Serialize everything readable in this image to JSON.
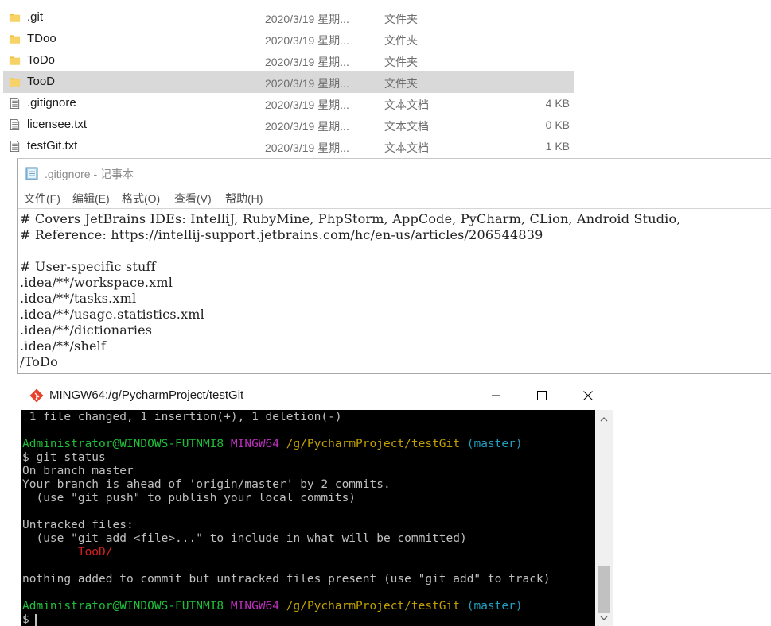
{
  "explorer": {
    "files": [
      {
        "name": ".git",
        "date": "2020/3/19 星期...",
        "type": "文件夹",
        "size": "",
        "icon": "folder-icon"
      },
      {
        "name": "TDoo",
        "date": "2020/3/19 星期...",
        "type": "文件夹",
        "size": "",
        "icon": "folder-icon"
      },
      {
        "name": "ToDo",
        "date": "2020/3/19 星期...",
        "type": "文件夹",
        "size": "",
        "icon": "folder-icon"
      },
      {
        "name": "TooD",
        "date": "2020/3/19 星期...",
        "type": "文件夹",
        "size": "",
        "icon": "folder-icon",
        "selected": true
      },
      {
        "name": ".gitignore",
        "date": "2020/3/19 星期...",
        "type": "文本文档",
        "size": "4 KB",
        "icon": "text-file-icon"
      },
      {
        "name": "licensee.txt",
        "date": "2020/3/19 星期...",
        "type": "文本文档",
        "size": "0 KB",
        "icon": "text-file-icon"
      },
      {
        "name": "testGit.txt",
        "date": "2020/3/19 星期...",
        "type": "文本文档",
        "size": "1 KB",
        "icon": "text-file-icon"
      }
    ]
  },
  "notepad": {
    "title": ".gitignore - 记事本",
    "menu": [
      "文件(F)",
      "编辑(E)",
      "格式(O)",
      "查看(V)",
      "帮助(H)"
    ],
    "lines": [
      "# Covers JetBrains IDEs: IntelliJ, RubyMine, PhpStorm, AppCode, PyCharm, CLion, Android Studio,",
      "# Reference: https://intellij-support.jetbrains.com/hc/en-us/articles/206544839",
      "",
      "# User-specific stuff",
      ".idea/**/workspace.xml",
      ".idea/**/tasks.xml",
      ".idea/**/usage.statistics.xml",
      ".idea/**/dictionaries",
      ".idea/**/shelf",
      "/ToDo"
    ]
  },
  "terminal": {
    "title": "MINGW64:/g/PycharmProject/testGit",
    "line1": " 1 file changed, 1 insertion(+), 1 deletion(-)",
    "prompt_user": "Administrator@WINDOWS-FUTNMI8",
    "prompt_env": "MINGW64",
    "prompt_path": "/g/PycharmProject/testGit",
    "prompt_branch": "(master)",
    "cmd": "$ git status",
    "out_branch": "On branch master",
    "out_ahead": "Your branch is ahead of 'origin/master' by 2 commits.",
    "out_hint": "  (use \"git push\" to publish your local commits)",
    "out_untracked": "Untracked files:",
    "out_add_hint": "  (use \"git add <file>...\" to include in what will be committed)",
    "out_file": "        TooD/",
    "out_nothing": "nothing added to commit but untracked files present (use \"git add\" to track)",
    "final_prompt": "$ "
  }
}
